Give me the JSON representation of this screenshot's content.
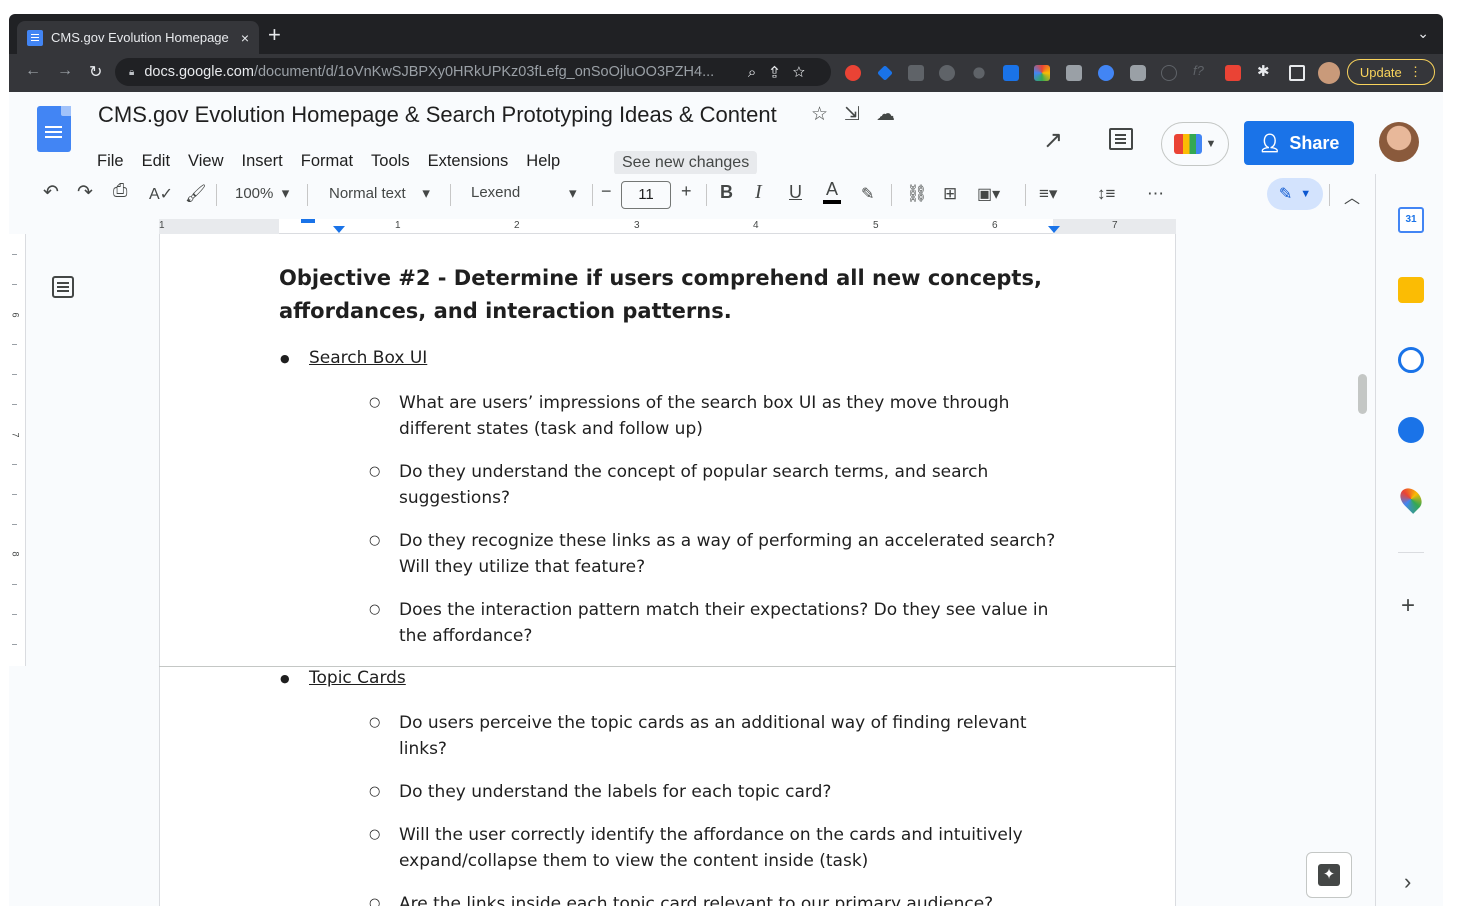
{
  "browser": {
    "tab_title": "CMS.gov Evolution Homepage",
    "tab_close": "×",
    "new_tab": "+",
    "tab_menu": "⌄",
    "url_domain": "docs.google.com",
    "url_path": "/document/d/1oVnKwSJBPXy0HRkUPKz03fLefg_onSoOjluOO3PZH4...",
    "update_label": "Update"
  },
  "docs": {
    "title": "CMS.gov Evolution Homepage & Search Prototyping Ideas & Content",
    "menus": [
      "File",
      "Edit",
      "View",
      "Insert",
      "Format",
      "Tools",
      "Extensions",
      "Help"
    ],
    "see_new_changes": "See new changes",
    "share_label": "Share"
  },
  "toolbar": {
    "zoom": "100%",
    "style": "Normal text",
    "font": "Lexend",
    "font_size": "11",
    "minus": "−",
    "plus": "+",
    "bold": "B",
    "italic": "I",
    "underline": "U",
    "text_color": "A"
  },
  "ruler": {
    "numbers": [
      "1",
      "1",
      "2",
      "3",
      "4",
      "5",
      "6",
      "7"
    ]
  },
  "vruler": {
    "numbers": [
      "6",
      "7",
      "8"
    ]
  },
  "document": {
    "heading": "Objective #2 - Determine if users comprehend all new concepts, affordances, and interaction patterns.",
    "section1_title": "Search Box UI",
    "section1_items": [
      "What are users’ impressions of the search box UI as they move through different states (task and follow up)",
      "Do they understand the concept of popular search terms, and search suggestions?",
      "Do they recognize these links as a way of performing an accelerated search? Will they utilize that feature?",
      "Does the interaction pattern match their expectations? Do they see value in the affordance?"
    ],
    "section2_title": "Topic Cards",
    "section2_items": [
      "Do users perceive the topic cards as an additional way of finding relevant links?",
      "Do they understand the labels for each topic card?",
      "Will the user correctly identify the affordance on the cards and intuitively expand/collapse them to view the content inside (task)",
      "Are the links inside each topic card relevant to our primary audience?"
    ]
  },
  "side_panel": {
    "calendar_day": "31",
    "add": "+",
    "collapse": "›"
  },
  "colors": {
    "accent": "#1a73e8",
    "chrome_dark": "#202124",
    "chrome_bar": "#35363a"
  }
}
